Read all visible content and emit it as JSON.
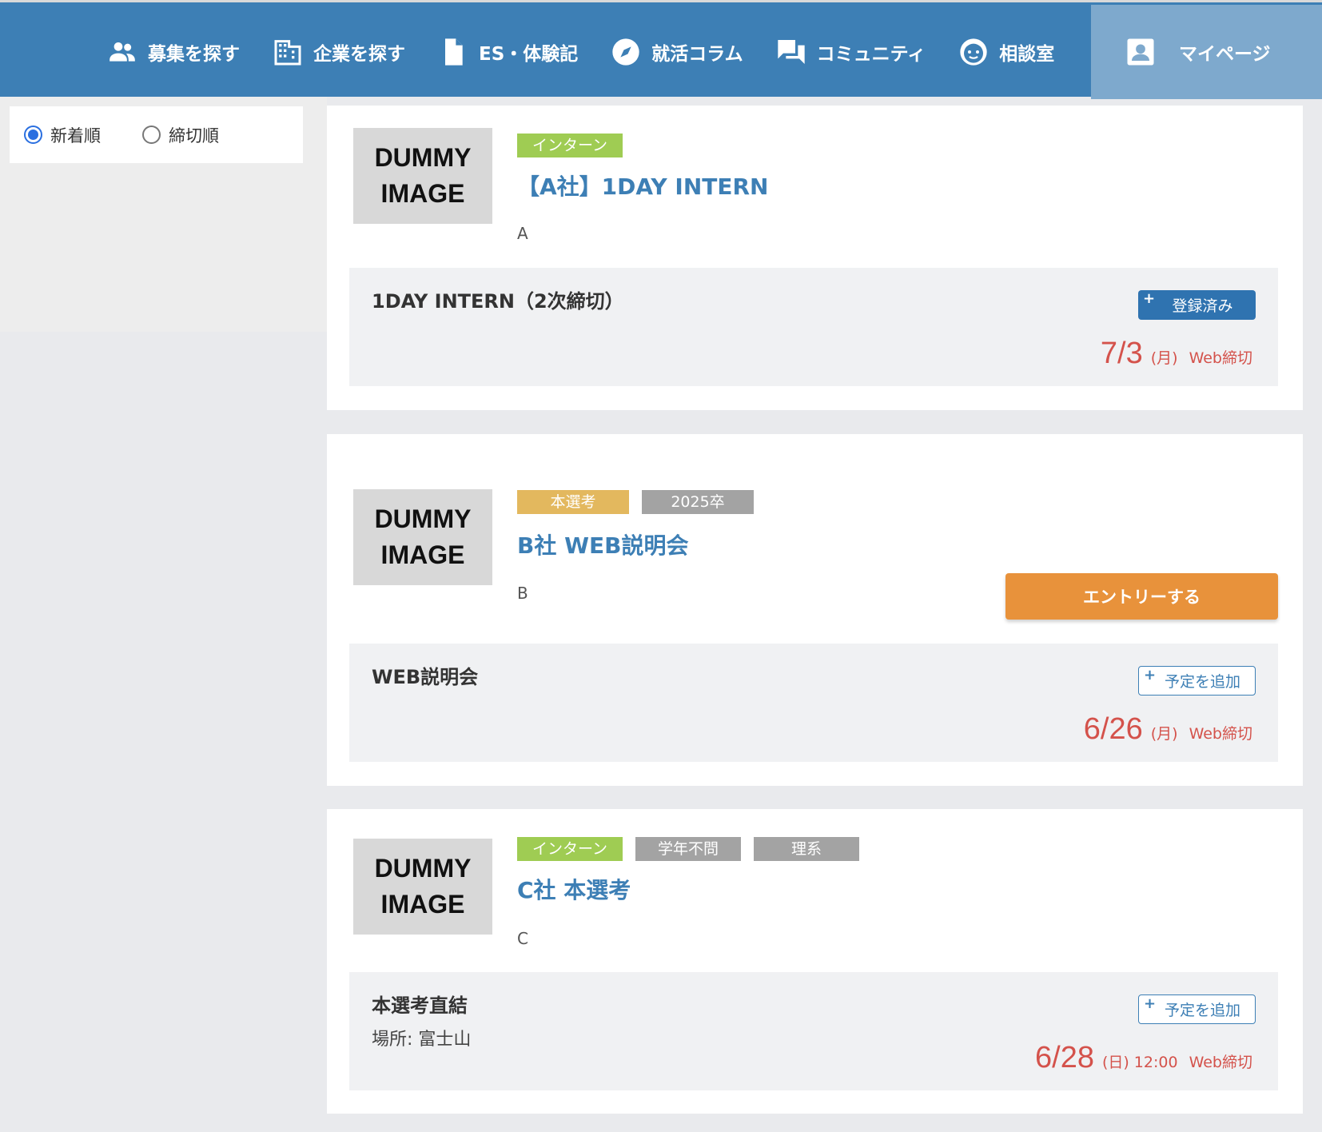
{
  "nav": {
    "items": [
      {
        "label": "募集を探す",
        "icon": "people-icon"
      },
      {
        "label": "企業を探す",
        "icon": "building-icon"
      },
      {
        "label": "ES・体験記",
        "icon": "document-icon"
      },
      {
        "label": "就活コラム",
        "icon": "compass-icon"
      },
      {
        "label": "コミュニティ",
        "icon": "chat-icon"
      },
      {
        "label": "相談室",
        "icon": "face-icon"
      }
    ],
    "mypage": {
      "label": "マイページ",
      "icon": "user-card-icon"
    }
  },
  "sort": {
    "options": [
      {
        "label": "新着順",
        "checked": true
      },
      {
        "label": "締切順",
        "checked": false
      }
    ]
  },
  "cards": [
    {
      "image_text": [
        "DUMMY",
        "IMAGE"
      ],
      "tags": [
        {
          "label": "インターン",
          "color": "#9fcc53"
        }
      ],
      "title": "【A社】1DAY INTERN",
      "company": "A",
      "detail": {
        "title": "1DAY INTERN（2次締切）",
        "sub": "",
        "button": {
          "plus": "+",
          "label": "登録済み",
          "state": "registered"
        },
        "deadline": {
          "date": "7/3",
          "dow": "(月)",
          "time": "",
          "label": "Web締切"
        }
      }
    },
    {
      "image_text": [
        "DUMMY",
        "IMAGE"
      ],
      "tags": [
        {
          "label": "本選考",
          "color": "#e3b85e"
        },
        {
          "label": "2025卒",
          "color": "#a3a3a3"
        }
      ],
      "title": "B社 WEB説明会",
      "company": "B",
      "entry_button": "エントリーする",
      "detail": {
        "title": "WEB説明会",
        "sub": "",
        "button": {
          "plus": "+",
          "label": "予定を追加",
          "state": "add"
        },
        "deadline": {
          "date": "6/26",
          "dow": "(月)",
          "time": "",
          "label": "Web締切"
        }
      }
    },
    {
      "image_text": [
        "DUMMY",
        "IMAGE"
      ],
      "tags": [
        {
          "label": "インターン",
          "color": "#9fcc53"
        },
        {
          "label": "学年不問",
          "color": "#a3a3a3"
        },
        {
          "label": "理系",
          "color": "#a3a3a3"
        }
      ],
      "title": "C社 本選考",
      "company": "C",
      "detail": {
        "title": "本選考直結",
        "sub": "場所: 富士山",
        "button": {
          "plus": "+",
          "label": "予定を追加",
          "state": "add"
        },
        "deadline": {
          "date": "6/28",
          "dow": "(日)",
          "time": "12:00",
          "label": "Web締切"
        }
      }
    }
  ],
  "colors": {
    "header": "#3d7fb5",
    "mypage_bg": "#7ea9cd",
    "title_link": "#3d7fb5",
    "deadline": "#d4524b",
    "entry_button": "#e8923b",
    "registered_button": "#2f73b0"
  }
}
